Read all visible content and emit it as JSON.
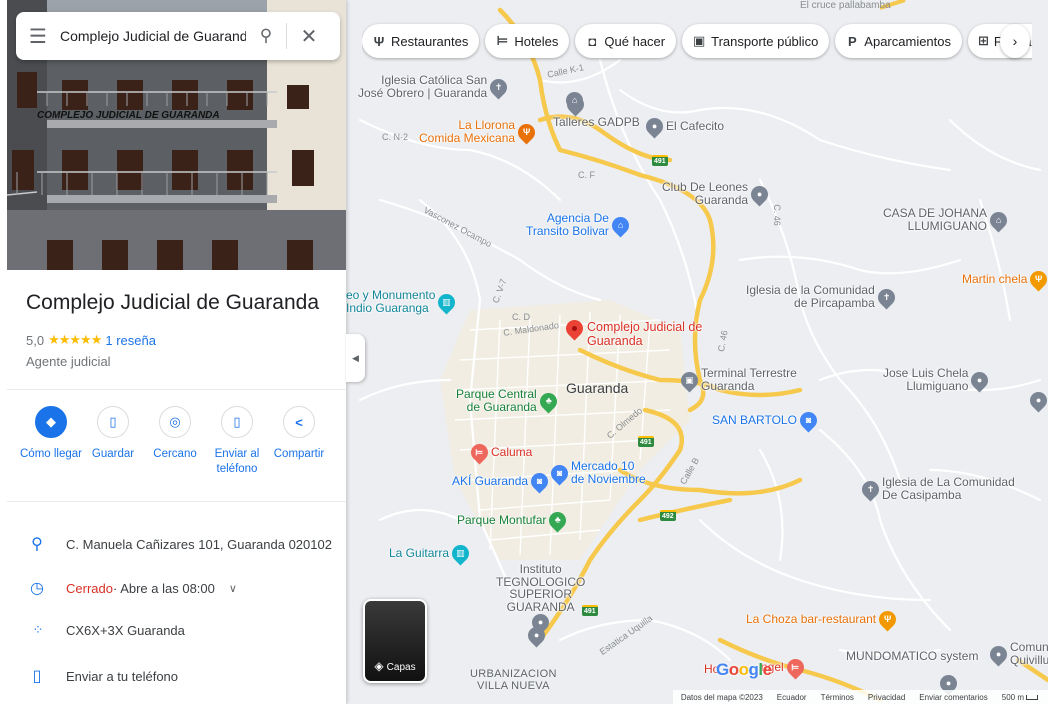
{
  "search": {
    "query": "Complejo Judicial de Guaranda"
  },
  "chips": [
    {
      "icon": "restaurant-icon",
      "glyph": "Ψ",
      "label": "Restaurantes"
    },
    {
      "icon": "hotel-icon",
      "glyph": "⊨",
      "label": "Hoteles"
    },
    {
      "icon": "camera-icon",
      "glyph": "◘",
      "label": "Qué hacer"
    },
    {
      "icon": "bus-icon",
      "glyph": "▣",
      "label": "Transporte público"
    },
    {
      "icon": "parking-icon",
      "glyph": "P",
      "label": "Aparcamientos"
    },
    {
      "icon": "pharmacy-icon",
      "glyph": "⊞",
      "label": "Farmacias"
    }
  ],
  "place": {
    "title": "Complejo Judicial de Guaranda",
    "rating": "5,0",
    "stars": "★★★★★",
    "reviews": "1 reseña",
    "category": "Agente judicial",
    "photo_sign": "COMPLEJO JUDICIAL DE GUARANDA"
  },
  "actions": [
    {
      "id": "directions",
      "icon": "directions-icon",
      "glyph": "◆",
      "label": "Cómo llegar",
      "primary": true
    },
    {
      "id": "save",
      "icon": "bookmark-icon",
      "glyph": "▯",
      "label": "Guardar"
    },
    {
      "id": "nearby",
      "icon": "nearby-icon",
      "glyph": "◎",
      "label": "Cercano"
    },
    {
      "id": "send",
      "icon": "phone-send-icon",
      "glyph": "▯",
      "label": "Enviar al teléfono"
    },
    {
      "id": "share",
      "icon": "share-icon",
      "glyph": "<",
      "label": "Compartir"
    }
  ],
  "info": {
    "address": "C. Manuela Cañizares 101, Guaranda 020102",
    "status": "Cerrado",
    "hours": " · Abre a las 08:00",
    "plus_code": "CX6X+3X Guaranda",
    "send_phone": "Enviar a tu teléfono"
  },
  "map": {
    "town": "Guaranda",
    "selected": "Complejo Judicial de Guaranda",
    "pois": [
      {
        "name": "Iglesia Católica San José Obrero | Guaranda",
        "l1": "Iglesia Católica San",
        "l2": "José Obrero | Guaranda",
        "color": "#7a8493"
      },
      {
        "name": "La Llorona Comida Mexicana",
        "l1": "La Llorona",
        "l2": "Comida Mexicana",
        "color": "#e8710a"
      },
      {
        "name": "Talleres GADPB",
        "l1": "Talleres GADPB",
        "l2": "",
        "color": "#7a8493"
      },
      {
        "name": "El Cafecito",
        "l1": "El Cafecito",
        "l2": "",
        "color": "#7a8493"
      },
      {
        "name": "Club De Leones Guaranda",
        "l1": "Club De Leones",
        "l2": "Guaranda",
        "color": "#7a8493"
      },
      {
        "name": "Agencia De Transito Bolivar",
        "l1": "Agencia De",
        "l2": "Transito Bolivar",
        "color": "#4285f4"
      },
      {
        "name": "CASA DE JOHANA LLUMIGUANO",
        "l1": "CASA DE JOHANA",
        "l2": "LLUMIGUANO",
        "color": "#7a8493"
      },
      {
        "name": "Museo y Monumento Indio Guaranga",
        "l1": "eo y Monumento",
        "l2": "Indio Guaranga",
        "color": "#12b5cb"
      },
      {
        "name": "Iglesia de la Comunidad de Pircapamba",
        "l1": "Iglesia de la Comunidad",
        "l2": "de Pircapamba",
        "color": "#7a8493"
      },
      {
        "name": "Martin chela",
        "l1": "Martin chela",
        "l2": "",
        "color": "#e8710a"
      },
      {
        "name": "Parque Central de Guaranda",
        "l1": "Parque Central",
        "l2": "de Guaranda",
        "color": "#34a853"
      },
      {
        "name": "Terminal Terrestre Guaranda",
        "l1": "Terminal Terrestre",
        "l2": "Guaranda",
        "color": "#7a8493"
      },
      {
        "name": "Jose Luis Chela Llumiguano",
        "l1": "Jose Luis Chela",
        "l2": "Llumiguano",
        "color": "#7a8493"
      },
      {
        "name": "SAN BARTOLO",
        "l1": "SAN BARTOLO",
        "l2": "",
        "color": "#4285f4"
      },
      {
        "name": "Caluma",
        "l1": "Caluma",
        "l2": "",
        "color": "#ee675c"
      },
      {
        "name": "AKÍ Guaranda",
        "l1": "AKÍ Guaranda",
        "l2": "",
        "color": "#4285f4"
      },
      {
        "name": "Mercado 10 de Noviembre",
        "l1": "Mercado 10",
        "l2": "de Noviembre",
        "color": "#4285f4"
      },
      {
        "name": "Iglesia de La Comunidad De Casipamba",
        "l1": "Iglesia de La Comunidad",
        "l2": "De Casipamba",
        "color": "#7a8493"
      },
      {
        "name": "Parque Montufar",
        "l1": "Parque Montufar",
        "l2": "",
        "color": "#34a853"
      },
      {
        "name": "La Guitarra",
        "l1": "La Guitarra",
        "l2": "",
        "color": "#12b5cb"
      },
      {
        "name": "Instituto TEGNOLOGICO SUPERIOR GUARANDA",
        "l1": "Instituto",
        "l2": "TEGNOLOGICO",
        "l3": "SUPERIOR",
        "l4": "GUARANDA",
        "color": "#7a8493"
      },
      {
        "name": "La Choza bar-restaurant",
        "l1": "La Choza bar-restaurant",
        "l2": "",
        "color": "#e8710a"
      },
      {
        "name": "MUNDOMATICO system",
        "l1": "MUNDOMATICO system",
        "l2": "",
        "color": "#7a8493"
      },
      {
        "name": "Comunidad Quivillungo",
        "l1": "Comuni",
        "l2": "Quivillur",
        "color": "#7a8493"
      },
      {
        "name": "Hostal Angel",
        "l1": "Ho",
        "l2": "ngel",
        "color": "#ee675c"
      }
    ],
    "streets": [
      "Calle K-1",
      "C. N-2",
      "C. F",
      "C. 46",
      "Vasconez Ocampo",
      "C. V-7",
      "C. D",
      "C. Maldonado",
      "C. 46",
      "C. Olmedo",
      "Calle B",
      "Estatica Uquilla",
      "El cruce pallabamba"
    ],
    "neighborhood_l1": "URBANIZACION",
    "neighborhood_l2": "VILLA NUEVA",
    "shields": [
      "491",
      "491",
      "492",
      "491"
    ],
    "layers_label": "Capas",
    "google": "Google",
    "footer": [
      "Datos del mapa ©2023",
      "Ecuador",
      "Términos",
      "Privacidad",
      "Enviar comentarios",
      "500 m"
    ]
  },
  "colors": {
    "accent": "#1a73e8",
    "closed": "#d93025",
    "star": "#fbbc04",
    "road_major": "#f6c84b",
    "road_minor": "#ffffff",
    "selected_pin": "#ea4335"
  }
}
